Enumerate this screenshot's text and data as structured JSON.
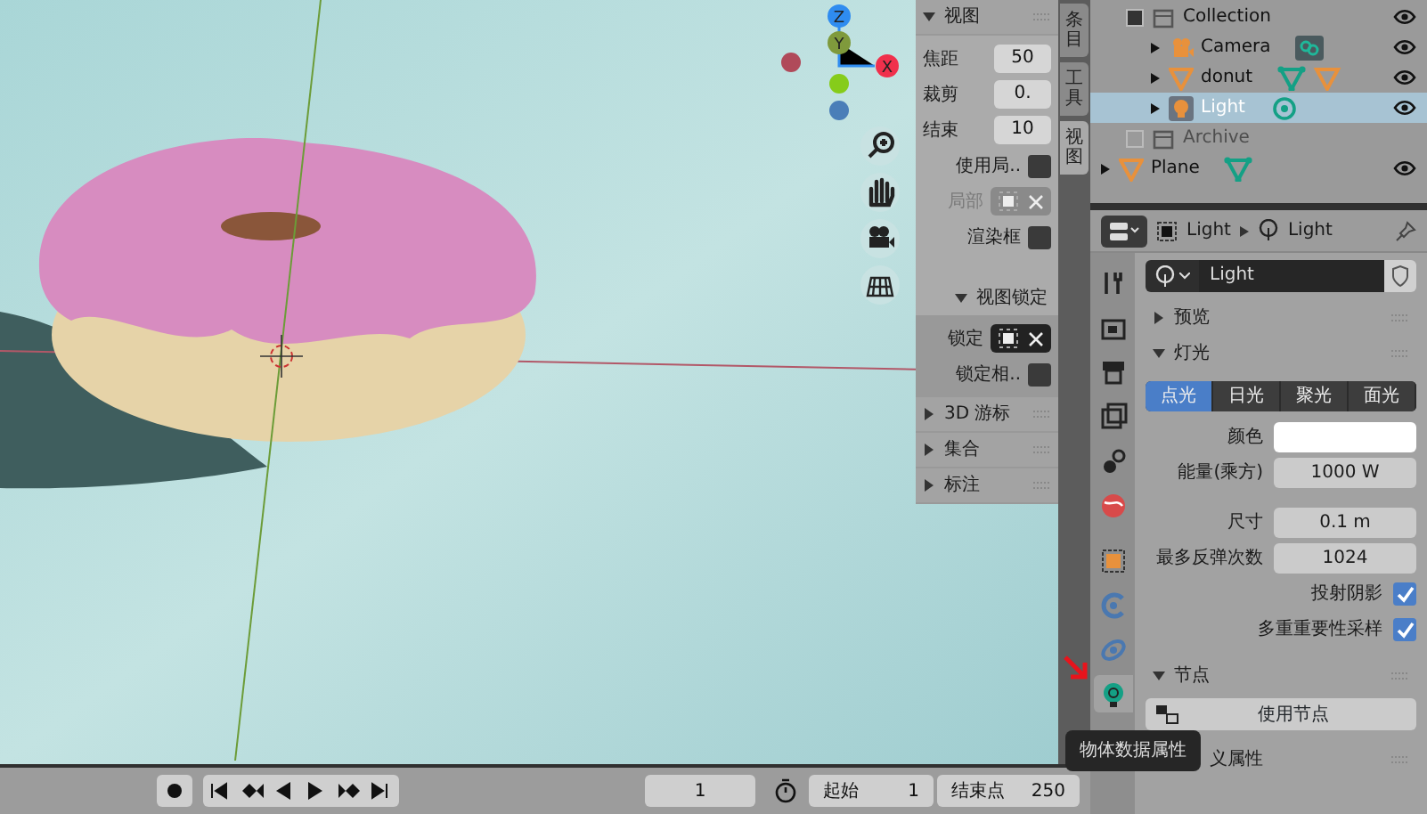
{
  "viewport": {
    "gizmo": [
      {
        "label": "Z",
        "color": "#2f8cf0"
      },
      {
        "label": "Y",
        "color": "#7f9a3c"
      },
      {
        "label": "X",
        "color": "#f0304c"
      }
    ],
    "sidebar_tabs": [
      {
        "label": "条目",
        "selected": false
      },
      {
        "label": "工具",
        "selected": false
      },
      {
        "label": "视图",
        "selected": true
      }
    ],
    "sidebar": {
      "panels": [
        {
          "title": "视图",
          "expanded": true,
          "fields": [
            {
              "kind": "number",
              "label": "焦距",
              "value": "50"
            },
            {
              "kind": "number",
              "label": "裁剪",
              "value": "0."
            },
            {
              "kind": "number",
              "label": "结束",
              "value": "10"
            },
            {
              "kind": "checkbox",
              "label": "使用局..",
              "checked": false
            },
            {
              "kind": "toggle",
              "label": "局部",
              "disabled": true
            },
            {
              "kind": "checkbox",
              "label": "渲染框",
              "checked": false
            }
          ]
        },
        {
          "title": "视图锁定",
          "expanded": true,
          "sub": true,
          "fields": [
            {
              "kind": "toggle",
              "label": "锁定",
              "disabled": false
            },
            {
              "kind": "checkbox",
              "label": "锁定相..",
              "checked": false
            }
          ]
        },
        {
          "title": "3D 游标",
          "expanded": false
        },
        {
          "title": "集合",
          "expanded": false
        },
        {
          "title": "标注",
          "expanded": false
        }
      ]
    }
  },
  "timeline": {
    "current_frame": "1",
    "start_label": "起始",
    "start": "1",
    "end_label": "结束点",
    "end": "250"
  },
  "outliner": {
    "rows": [
      {
        "label": "Collection",
        "kind": "collection",
        "checked": true,
        "selected": false,
        "children": [
          {
            "label": "Camera",
            "kind": "camera",
            "selected": false,
            "data_icons": [
              {
                "kind": "camera"
              }
            ]
          },
          {
            "label": "donut",
            "kind": "mesh",
            "selected": false,
            "data_icons": [
              {
                "kind": "mesh"
              },
              {
                "kind": "modifier"
              }
            ]
          },
          {
            "label": "Light",
            "kind": "light",
            "selected": true,
            "data_icons": [
              {
                "kind": "light"
              }
            ]
          }
        ]
      },
      {
        "label": "Archive",
        "kind": "collection",
        "checked": false,
        "selected": false
      },
      {
        "label": "Plane",
        "kind": "mesh",
        "selected": false,
        "data_icons": [
          {
            "kind": "mesh"
          }
        ]
      }
    ]
  },
  "properties": {
    "header": {
      "object": "Light",
      "data": "Light"
    },
    "tabs": [
      {
        "kind": "tool",
        "selected": false
      },
      {
        "kind": "render",
        "selected": false
      },
      {
        "kind": "output",
        "selected": false
      },
      {
        "kind": "view_layer",
        "selected": false
      },
      {
        "kind": "scene",
        "selected": false
      },
      {
        "kind": "world",
        "selected": false
      },
      {
        "kind": "object",
        "selected": false
      },
      {
        "kind": "constraint",
        "selected": false
      },
      {
        "kind": "physics",
        "selected": false
      },
      {
        "kind": "data",
        "selected": true
      }
    ],
    "datablock": "Light",
    "panels": [
      {
        "kind": "plain",
        "title": "预览",
        "expanded": false
      },
      {
        "kind": "light",
        "title": "灯光",
        "expanded": true,
        "types": [
          {
            "label": "点光",
            "selected": true
          },
          {
            "label": "日光",
            "selected": false
          },
          {
            "label": "聚光",
            "selected": false
          },
          {
            "label": "面光",
            "selected": false
          }
        ],
        "fields": [
          {
            "kind": "color",
            "label": "颜色",
            "color": "#ffffff"
          },
          {
            "kind": "value",
            "label": "能量(乘方)",
            "value": "1000 W"
          },
          {
            "kind": "value",
            "label": "尺寸",
            "value": "0.1 m"
          },
          {
            "kind": "value",
            "label": "最多反弹次数",
            "value": "1024"
          },
          {
            "kind": "checkbox",
            "label": "投射阴影",
            "checked": true
          },
          {
            "kind": "checkbox",
            "label": "多重重要性采样",
            "checked": true
          }
        ]
      },
      {
        "kind": "nodes",
        "title": "节点",
        "expanded": true,
        "button": "使用节点"
      },
      {
        "kind": "covered",
        "title": "义属性",
        "expanded": false
      }
    ],
    "tooltip": "物体数据属性"
  }
}
